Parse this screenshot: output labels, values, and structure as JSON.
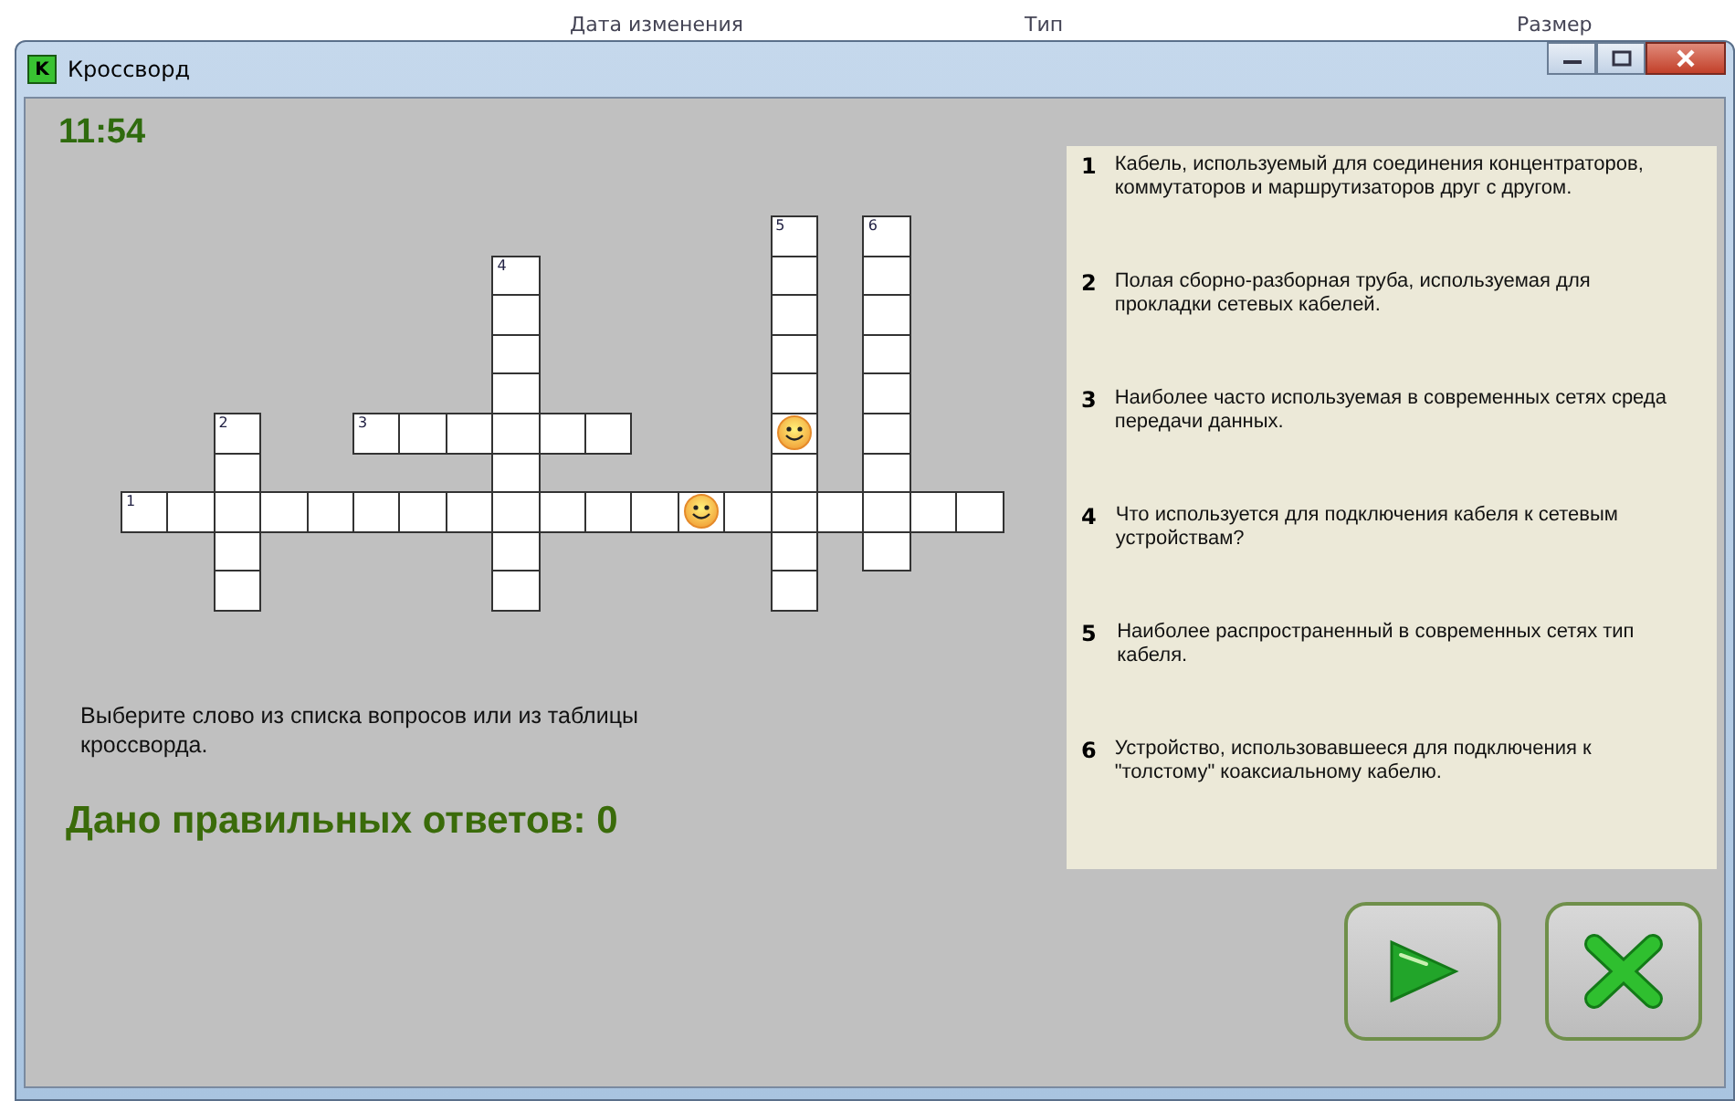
{
  "background_columns": [
    "Дата изменения",
    "Тип",
    "Размер"
  ],
  "window": {
    "title": "Кроссворд",
    "app_icon": "K"
  },
  "timer": "11:54",
  "crossword": {
    "words": [
      {
        "number": "1",
        "cells": [
          {
            "smiley": false
          },
          {
            "smiley": false
          },
          {
            "smiley": false
          },
          {
            "smiley": false
          },
          {
            "smiley": false
          },
          {
            "smiley": false
          },
          {
            "smiley": false
          },
          {
            "smiley": false
          },
          {
            "smiley": false
          },
          {
            "smiley": false
          },
          {
            "smiley": false
          },
          {
            "smiley": false
          },
          {
            "smiley": true
          },
          {
            "smiley": false
          },
          {
            "smiley": false
          },
          {
            "smiley": false
          },
          {
            "smiley": false
          },
          {
            "smiley": false
          },
          {
            "smiley": false
          }
        ]
      },
      {
        "number": "2",
        "cells": [
          {
            "smiley": false
          },
          {
            "smiley": false
          },
          {
            "smiley": false
          },
          {
            "smiley": false
          },
          {
            "smiley": false
          }
        ]
      },
      {
        "number": "3",
        "cells": [
          {
            "smiley": false
          },
          {
            "smiley": false
          },
          {
            "smiley": false
          },
          {
            "smiley": false
          },
          {
            "smiley": false
          },
          {
            "smiley": false
          }
        ]
      },
      {
        "number": "4",
        "cells": [
          {
            "smiley": false
          },
          {
            "smiley": false
          },
          {
            "smiley": false
          },
          {
            "smiley": false
          },
          {
            "smiley": false
          },
          {
            "smiley": false
          },
          {
            "smiley": false
          },
          {
            "smiley": false
          },
          {
            "smiley": false
          }
        ]
      },
      {
        "number": "5",
        "cells": [
          {
            "smiley": false
          },
          {
            "smiley": false
          },
          {
            "smiley": false
          },
          {
            "smiley": false
          },
          {
            "smiley": false
          },
          {
            "smiley": true
          },
          {
            "smiley": false
          },
          {
            "smiley": false
          },
          {
            "smiley": false
          },
          {
            "smiley": false
          }
        ]
      },
      {
        "number": "6",
        "cells": [
          {
            "smiley": false
          },
          {
            "smiley": false
          },
          {
            "smiley": false
          },
          {
            "smiley": false
          },
          {
            "smiley": false
          },
          {
            "smiley": false
          },
          {
            "smiley": false
          },
          {
            "smiley": false
          },
          {
            "smiley": false
          }
        ]
      }
    ]
  },
  "instruction": "Выберите слово из списка вопросов или из таблицы кроссворда.",
  "score": "Дано правильных ответов: 0",
  "clues": [
    {
      "number": "1",
      "text": "Кабель, используемый для соединения концентраторов, коммутаторов и маршрутизаторов друг с другом."
    },
    {
      "number": "2",
      "text": "Полая сборно-разборная труба, используемая для прокладки сетевых кабелей."
    },
    {
      "number": "3",
      "text": "Наиболее часто используемая в современных сетях среда передачи данных."
    },
    {
      "number": "4",
      "text": "Что используется для подключения кабеля к сетевым устройствам?"
    },
    {
      "number": "5",
      "text": "Наиболее распространенный в современных сетях тип кабеля."
    },
    {
      "number": "6",
      "text": "Устройство, использовавшееся для подключения к \"толстому\" коаксиальному кабелю."
    }
  ],
  "buttons": [
    {
      "kind": "next"
    },
    {
      "kind": "close"
    }
  ]
}
